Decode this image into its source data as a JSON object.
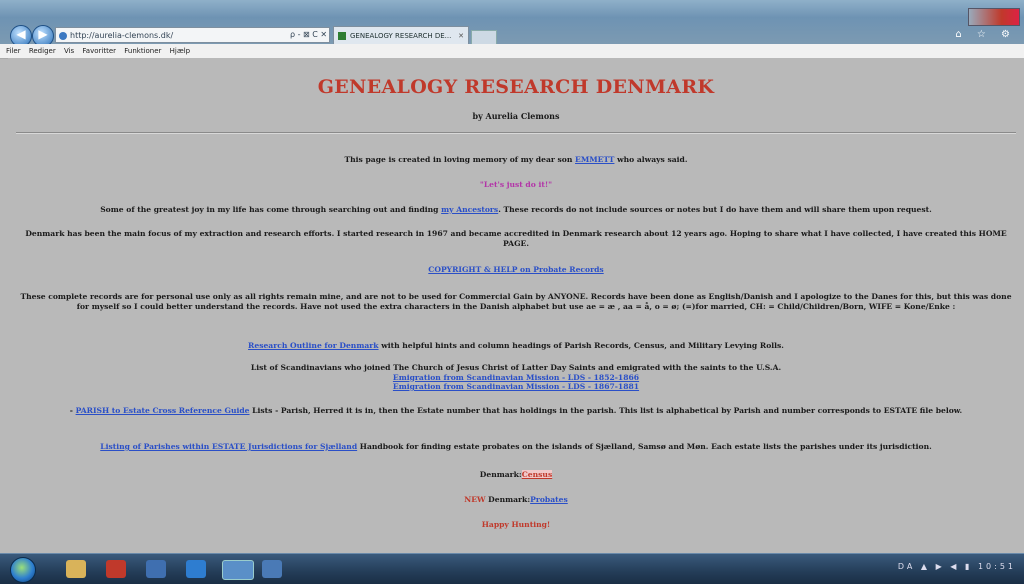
{
  "browser": {
    "address_url": "http://aurelia-clemons.dk/",
    "address_controls": "ρ - ⊠ C ✕",
    "tab_title": "GENEALOGY RESEARCH DE...",
    "tab_close": "✕",
    "menu": [
      "Filer",
      "Rediger",
      "Vis",
      "Favoritter",
      "Funktioner",
      "Hjælp"
    ],
    "right_icons": "⌂ ☆ ⚙"
  },
  "page": {
    "title": "GENEALOGY RESEARCH DENMARK",
    "byline": "by Aurelia Clemons",
    "memory": {
      "before": "This page is created in loving memory of my dear son ",
      "link": "EMMETT",
      "after": " who always said."
    },
    "quote": "\"Let's just do it!\"",
    "joy": {
      "before": "Some of the greatest joy in my life has come through searching out and finding ",
      "link": "my Ancestors",
      "after": ". These records do not include sources or notes but I do have them and will share them upon request."
    },
    "focus": "Denmark has been the main focus of my extraction and research efforts. I started research in 1967 and became accredited in Denmark research about 12 years ago. Hoping to share what I have collected, I have created this HOME PAGE.",
    "copyright_link": "COPYRIGHT & HELP on Probate Records",
    "personal_use": "These complete records are for personal use only as all rights remain mine, and are not to be used for Commercial Gain by ANYONE. Records have been done as English/Danish and I apologize to the Danes for this, but this was done for myself so I could better understand the records. Have not used the extra characters in the Danish alphabet but use ae = æ , aa = å, o = ø; (=)for married, CH: = Child/Children/Born, WIFE = Kone/Enke :",
    "outline": {
      "link": "Research Outline for Denmark",
      "after": " with helpful hints and column headings of Parish Records, Census, and Military Levying Rolls."
    },
    "scandinavians": "List of Scandinavians who joined The Church of Jesus Christ of Latter Day Saints and emigrated with the saints to the U.S.A.",
    "emigration_1": "Emigration from Scandinavian Mission - LDS - 1852-1866",
    "emigration_2": "Emigration from Scandinavian Mission - LDS - 1867-1881",
    "parish": {
      "prefix": "- ",
      "link": "PARISH to Estate Cross Reference Guide",
      "after": " Lists - Parish, Herred it is in, then the Estate number that has holdings in the parish. This list is alphabetical by Parish and number corresponds to ESTATE file below."
    },
    "listing": {
      "link": "Listing of Parishes within ESTATE Jurisdictions for Sjælland",
      "after": " Handbook for finding estate probates on the islands of Sjælland, Samsø and Møn. Each estate lists the parishes under its jurisdiction."
    },
    "census": {
      "label": "Denmark:",
      "link": "Census"
    },
    "probates": {
      "new": "NEW",
      "label": " Denmark:",
      "link": "Probates"
    },
    "happy": "Happy Hunting!"
  },
  "taskbar": {
    "tray": "DA ▲ ▶ ◀ ▮ 10:51"
  }
}
